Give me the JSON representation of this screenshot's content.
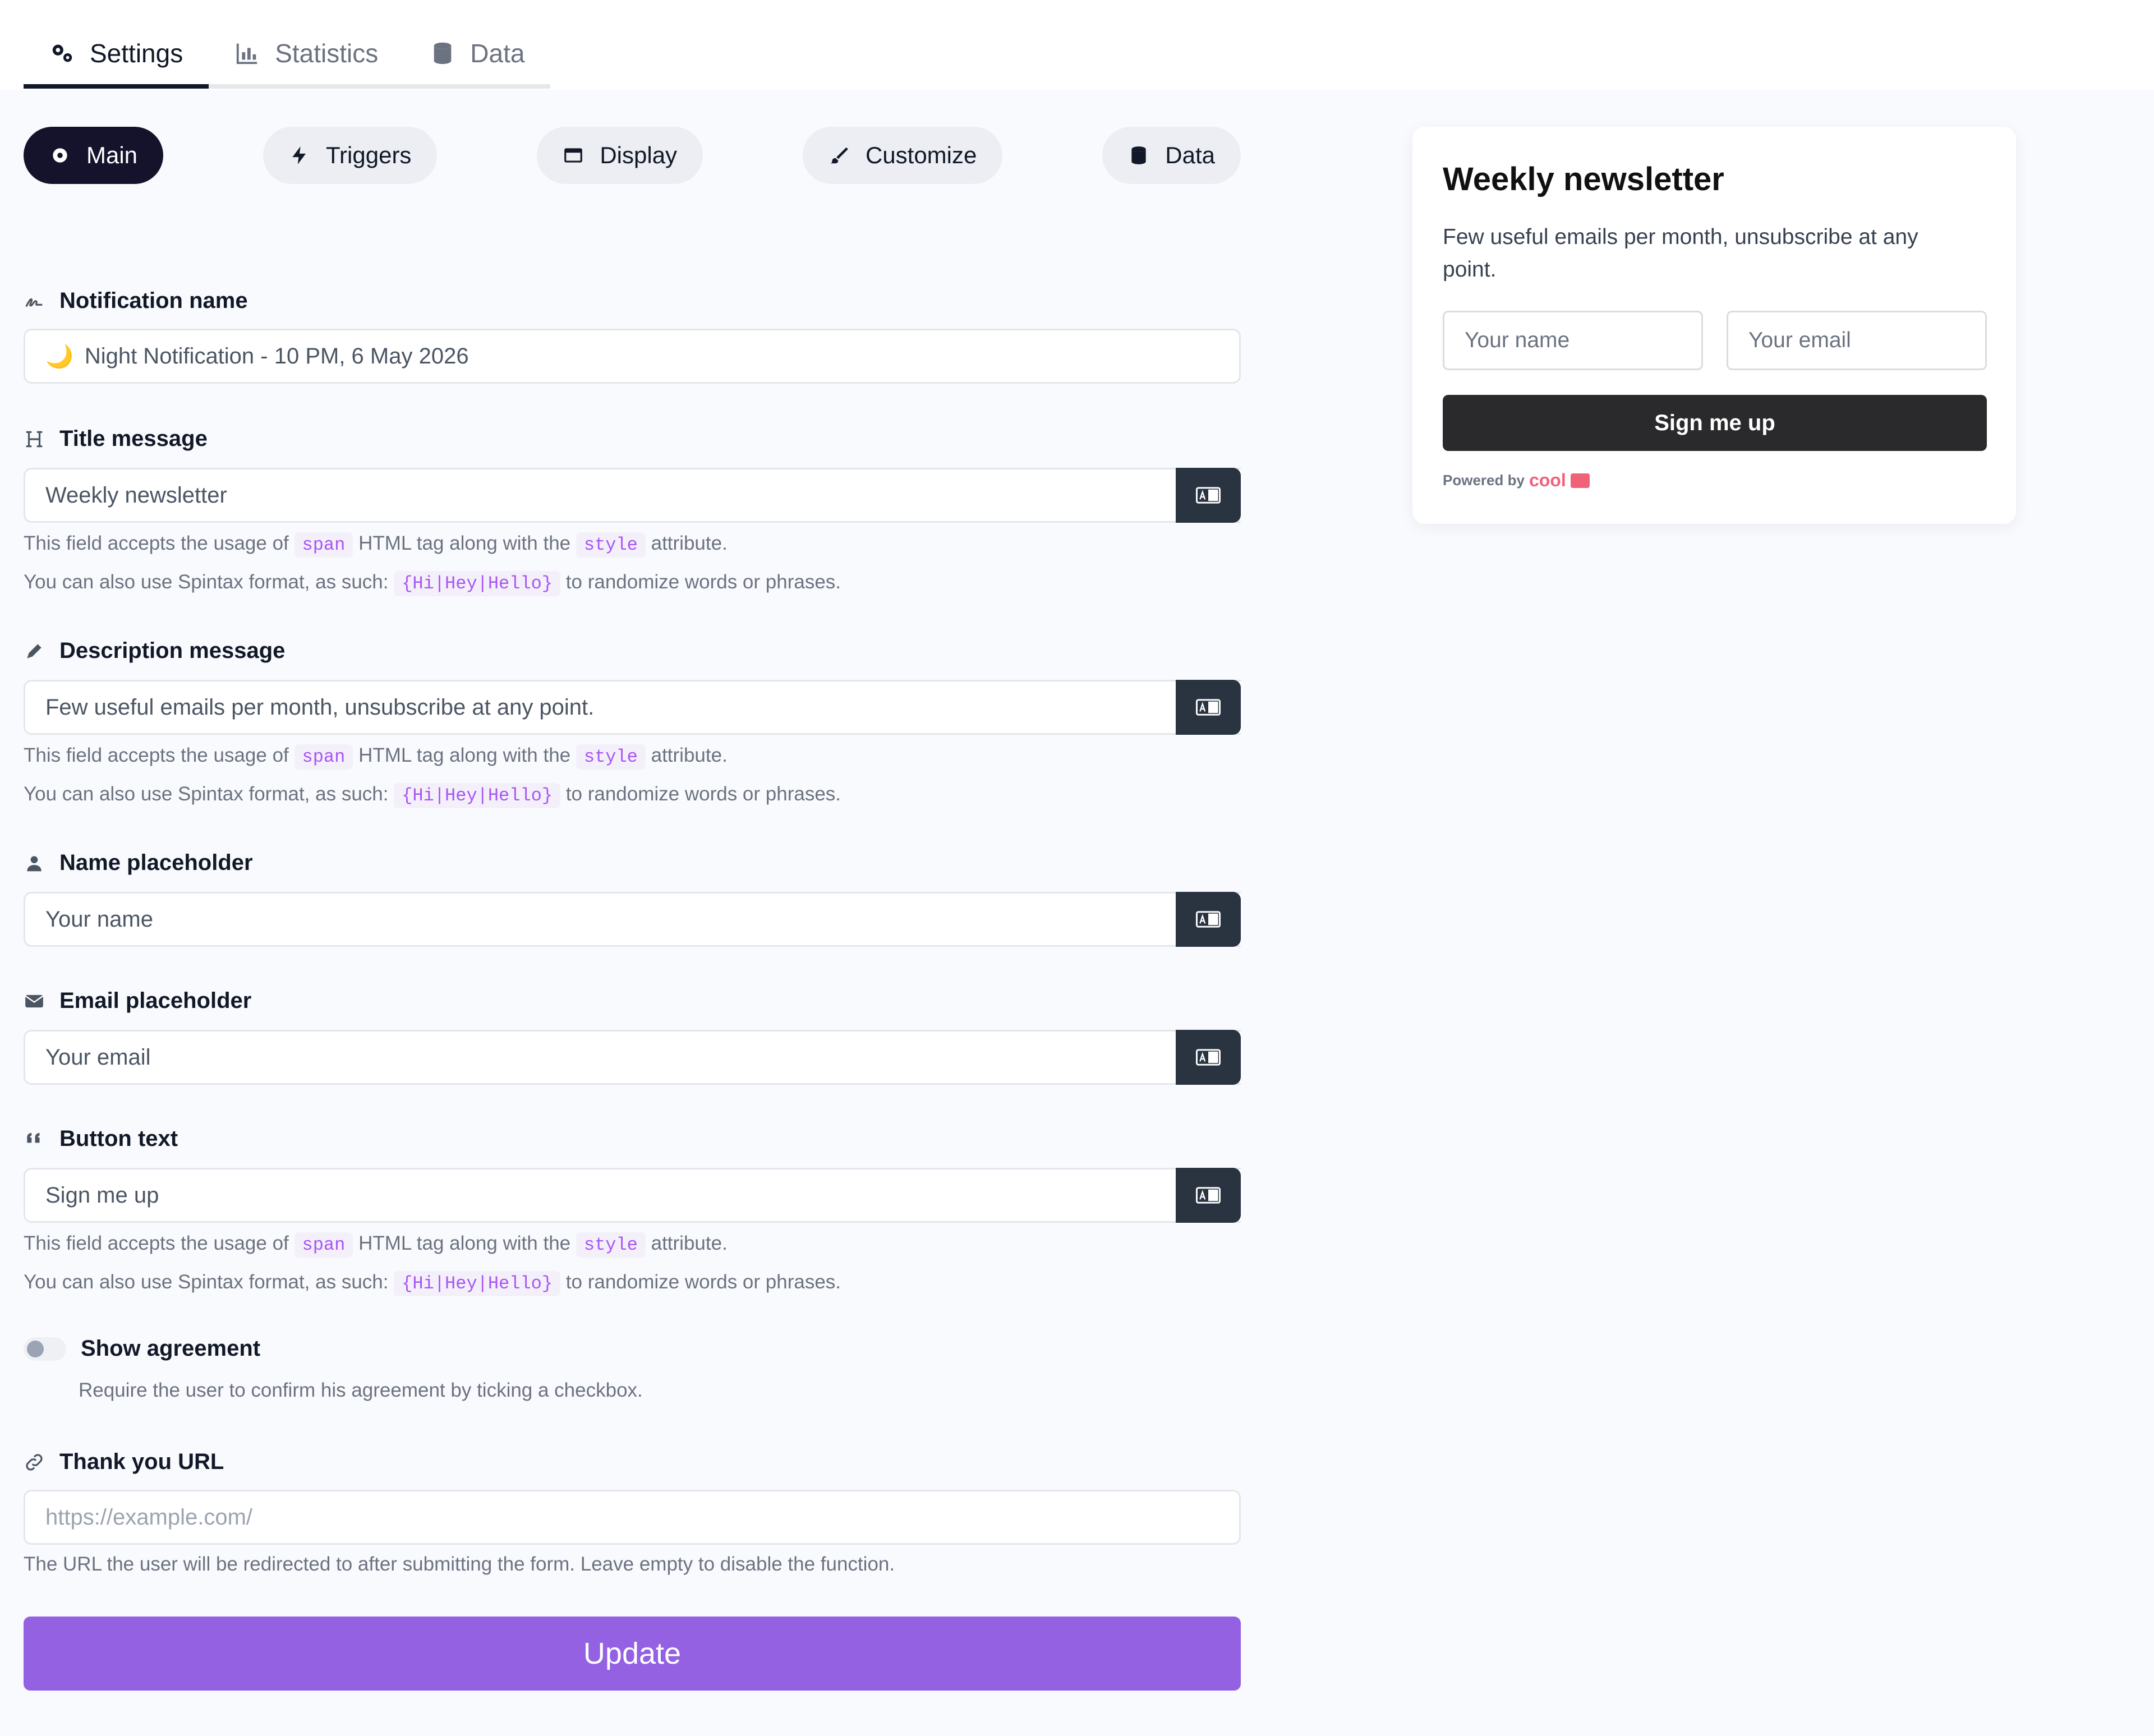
{
  "top_tabs": [
    {
      "label": "Settings",
      "icon": "gears-icon",
      "active": true
    },
    {
      "label": "Statistics",
      "icon": "chart-icon",
      "active": false
    },
    {
      "label": "Data",
      "icon": "database-icon",
      "active": false
    }
  ],
  "section_pills": [
    {
      "label": "Main",
      "icon": "gear-icon",
      "active": true
    },
    {
      "label": "Triggers",
      "icon": "bolt-icon",
      "active": false
    },
    {
      "label": "Display",
      "icon": "window-icon",
      "active": false
    },
    {
      "label": "Customize",
      "icon": "paintbrush-icon",
      "active": false
    },
    {
      "label": "Data",
      "icon": "database-icon",
      "active": false
    }
  ],
  "form": {
    "notification_name": {
      "label": "Notification name",
      "emoji": "🌙",
      "value": "Night Notification - 10 PM, 6 May 2026"
    },
    "title_message": {
      "label": "Title message",
      "value": "Weekly newsletter"
    },
    "description_message": {
      "label": "Description message",
      "value": "Few useful emails per month, unsubscribe at any point."
    },
    "name_placeholder": {
      "label": "Name placeholder",
      "value": "Your name"
    },
    "email_placeholder": {
      "label": "Email placeholder",
      "value": "Your email"
    },
    "button_text": {
      "label": "Button text",
      "value": "Sign me up"
    },
    "help": {
      "line1_a": "This field accepts the usage of",
      "line1_code1": "span",
      "line1_b": "HTML tag along with the",
      "line1_code2": "style",
      "line1_c": "attribute.",
      "line2_a": "You can also use Spintax format, as such:",
      "line2_code": "{Hi|Hey|Hello}",
      "line2_b": "to randomize words or phrases."
    },
    "show_agreement": {
      "label": "Show agreement",
      "help": "Require the user to confirm his agreement by ticking a checkbox.",
      "enabled": false
    },
    "thank_you_url": {
      "label": "Thank you URL",
      "placeholder": "https://example.com/",
      "help": "The URL the user will be redirected to after submitting the form. Leave empty to disable the function."
    },
    "update_label": "Update"
  },
  "preview": {
    "title": "Weekly newsletter",
    "description": "Few useful emails per month, unsubscribe at any point.",
    "name_placeholder": "Your name",
    "email_placeholder": "Your email",
    "button": "Sign me up",
    "powered_by": "Powered by",
    "brand": "cool"
  },
  "colors": {
    "accent": "#9461e3",
    "dark": "#15132b",
    "input_button": "#2a3441",
    "code": "#a855f7"
  }
}
